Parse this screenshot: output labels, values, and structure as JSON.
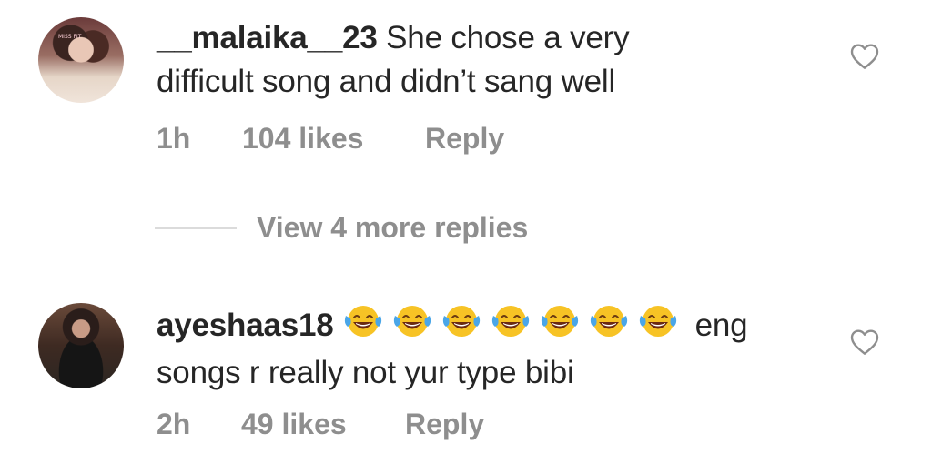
{
  "comments": [
    {
      "username": "__malaika__23",
      "text_line1": "She chose a very",
      "text_line2": "difficult song and didn’t sang well",
      "time": "1h",
      "likes": "104 likes",
      "reply": "Reply",
      "avatar_tag": "MISS FIT",
      "icon": "heart-outline-icon"
    },
    {
      "username": "ayeshaas18",
      "emoji_name": "face-with-tears-of-joy-emoji",
      "emoji_count": 7,
      "text_tail": "eng",
      "text_line2": "songs r really not yur type bibi",
      "time": "2h",
      "likes": "49 likes",
      "reply": "Reply",
      "icon": "heart-outline-icon"
    }
  ],
  "view_replies": "View 4 more replies",
  "colors": {
    "text": "#262626",
    "muted": "#8e8e8e",
    "divider": "#dbdbdb"
  }
}
